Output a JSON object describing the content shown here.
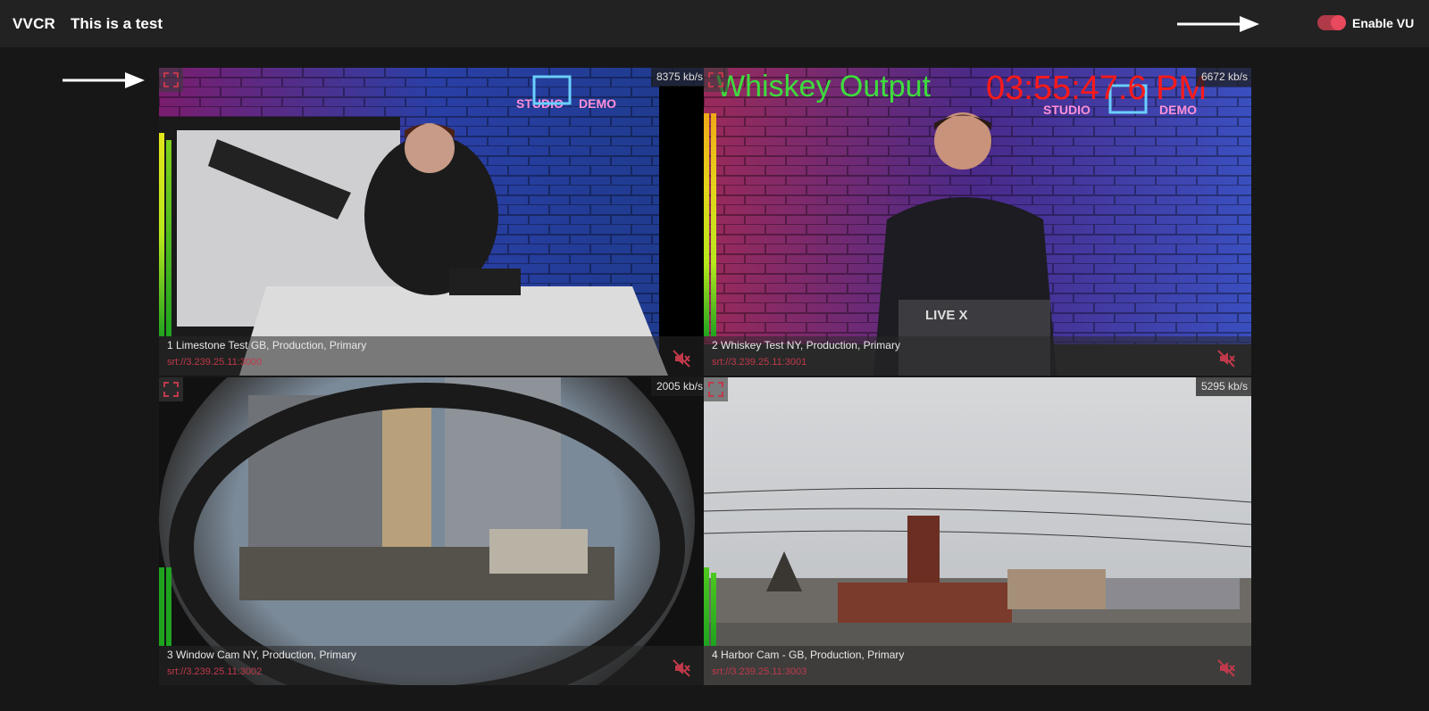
{
  "header": {
    "app_name": "VVCR",
    "page_title": "This is a test",
    "vu_toggle_label": "Enable VU",
    "vu_enabled": true
  },
  "colors": {
    "accent": "#e8495c",
    "url_text": "#c0394a",
    "background": "#171717",
    "topbar": "#222222"
  },
  "tiles": [
    {
      "name": "1 Limestone Test GB, Production, Primary",
      "url": "srt://3.239.25.11:3000",
      "bitrate": "8375 kb/s",
      "muted": true,
      "vu_level_left": 0.9,
      "vu_level_right": 0.9
    },
    {
      "name": "2 Whiskey Test NY, Production, Primary",
      "url": "srt://3.239.25.11:3001",
      "bitrate": "6672 kb/s",
      "muted": true,
      "vu_level_left": 0.98,
      "vu_level_right": 0.98,
      "osd_title": "Whiskey Output",
      "osd_time": "03:55:47.6 PM"
    },
    {
      "name": "3 Window Cam NY, Production, Primary",
      "url": "srt://3.239.25.11:3002",
      "bitrate": "2005 kb/s",
      "muted": true,
      "vu_level_left": 0.3,
      "vu_level_right": 0.3
    },
    {
      "name": "4 Harbor Cam - GB, Production, Primary",
      "url": "srt://3.239.25.11:3003",
      "bitrate": "5295 kb/s",
      "muted": true,
      "vu_level_left": 0.3,
      "vu_level_right": 0.28
    }
  ],
  "icons": {
    "expand": "expand-icon",
    "mute": "speaker-muted-icon",
    "annotation_arrow": "arrow-right-icon"
  }
}
